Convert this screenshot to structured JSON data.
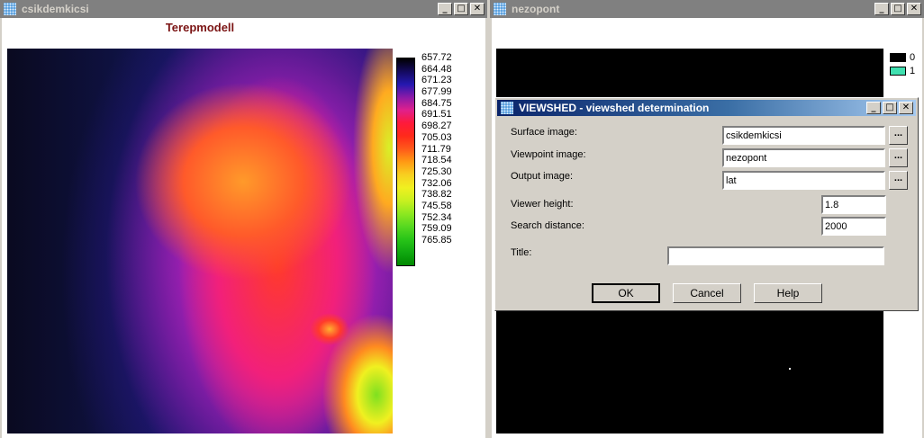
{
  "left_window": {
    "title": "csikdemkicsi",
    "plot_title": "Terepmodell",
    "colorbar": {
      "labels": [
        "657.72",
        "664.48",
        "671.23",
        "677.99",
        "684.75",
        "691.51",
        "698.27",
        "705.03",
        "711.79",
        "718.54",
        "725.30",
        "732.06",
        "738.82",
        "745.58",
        "752.34",
        "759.09",
        "765.85"
      ],
      "colors": [
        "#000000",
        "#140a5e",
        "#2418b0",
        "#8c1aa8",
        "#e0208c",
        "#ff1a3a",
        "#ff2a1a",
        "#ff5a1a",
        "#ff9a14",
        "#f8d020",
        "#f0f020",
        "#c8f020",
        "#8ee820",
        "#56d820",
        "#28c418",
        "#10a810",
        "#008800"
      ]
    }
  },
  "right_window": {
    "title": "nezopont",
    "legend": [
      {
        "label": "0",
        "color": "#000000"
      },
      {
        "label": "1",
        "color": "#40e0b0"
      }
    ]
  },
  "dialog": {
    "title": "VIEWSHED - viewshed determination",
    "fields": {
      "surface_label": "Surface image:",
      "surface_value": "csikdemkicsi",
      "viewpoint_label": "Viewpoint image:",
      "viewpoint_value": "nezopont",
      "output_label": "Output image:",
      "output_value": "lat",
      "viewer_height_label": "Viewer height:",
      "viewer_height_value": "1.8",
      "search_distance_label": "Search distance:",
      "search_distance_value": "2000",
      "title_label": "Title:",
      "title_value": ""
    },
    "browse_label": "...",
    "buttons": {
      "ok": "OK",
      "cancel": "Cancel",
      "help": "Help"
    }
  },
  "window_controls": {
    "minimize": "_",
    "maximize": "□",
    "close": "✕"
  },
  "colors": {
    "inactive_title": "#808080",
    "active_title_start": "#0a246a",
    "plot_title": "#7b1414"
  }
}
